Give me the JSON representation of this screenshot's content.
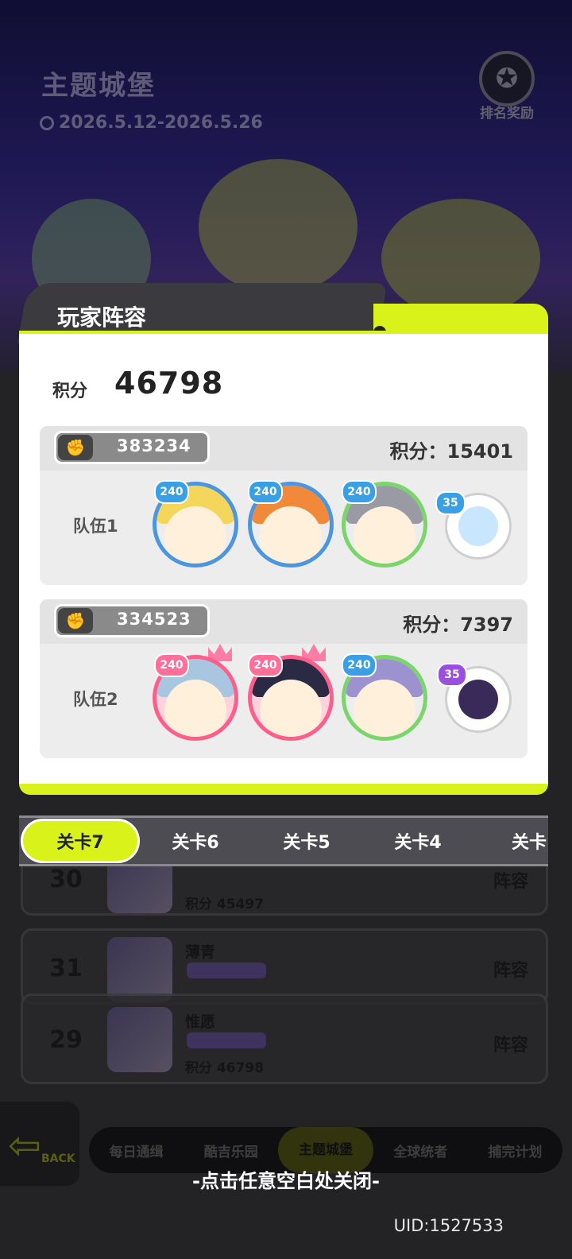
{
  "header": {
    "title": "主题城堡",
    "dates": "2026.5.12-2026.5.26",
    "reward_label": "排名奖励"
  },
  "modal": {
    "title": "玩家阵容",
    "total_label": "积分",
    "total_value": "46798",
    "teams": [
      {
        "player_id": "383234",
        "score_text": "积分：15401",
        "label": "队伍1",
        "hero_levels": [
          "240",
          "240",
          "240"
        ],
        "pet_level": "35"
      },
      {
        "player_id": "334523",
        "score_text": "积分：7397",
        "label": "队伍2",
        "hero_levels": [
          "240",
          "240",
          "240"
        ],
        "pet_level": "35"
      }
    ]
  },
  "stage_tabs": [
    "关卡7",
    "关卡6",
    "关卡5",
    "关卡4",
    "关卡"
  ],
  "ranking": [
    {
      "rank": "30",
      "name": "",
      "score": "积分  45497",
      "lineup": "阵容"
    },
    {
      "rank": "31",
      "name": "薄青",
      "score": "",
      "lineup": "阵容"
    },
    {
      "rank": "29",
      "name": "惟愿",
      "score": "积分  46798",
      "lineup": "阵容"
    }
  ],
  "back": {
    "label": "BACK"
  },
  "bottom_nav": [
    "每日通缉",
    "酷吉乐园",
    "主题城堡",
    "全球统者",
    "捕完计划"
  ],
  "close_hint": "-点击任意空白处关闭-",
  "uid": "UID:1527533",
  "colors": {
    "accent": "#d8f21a",
    "modal_bg": "#ffffff",
    "dark": "#3b3b3f"
  }
}
